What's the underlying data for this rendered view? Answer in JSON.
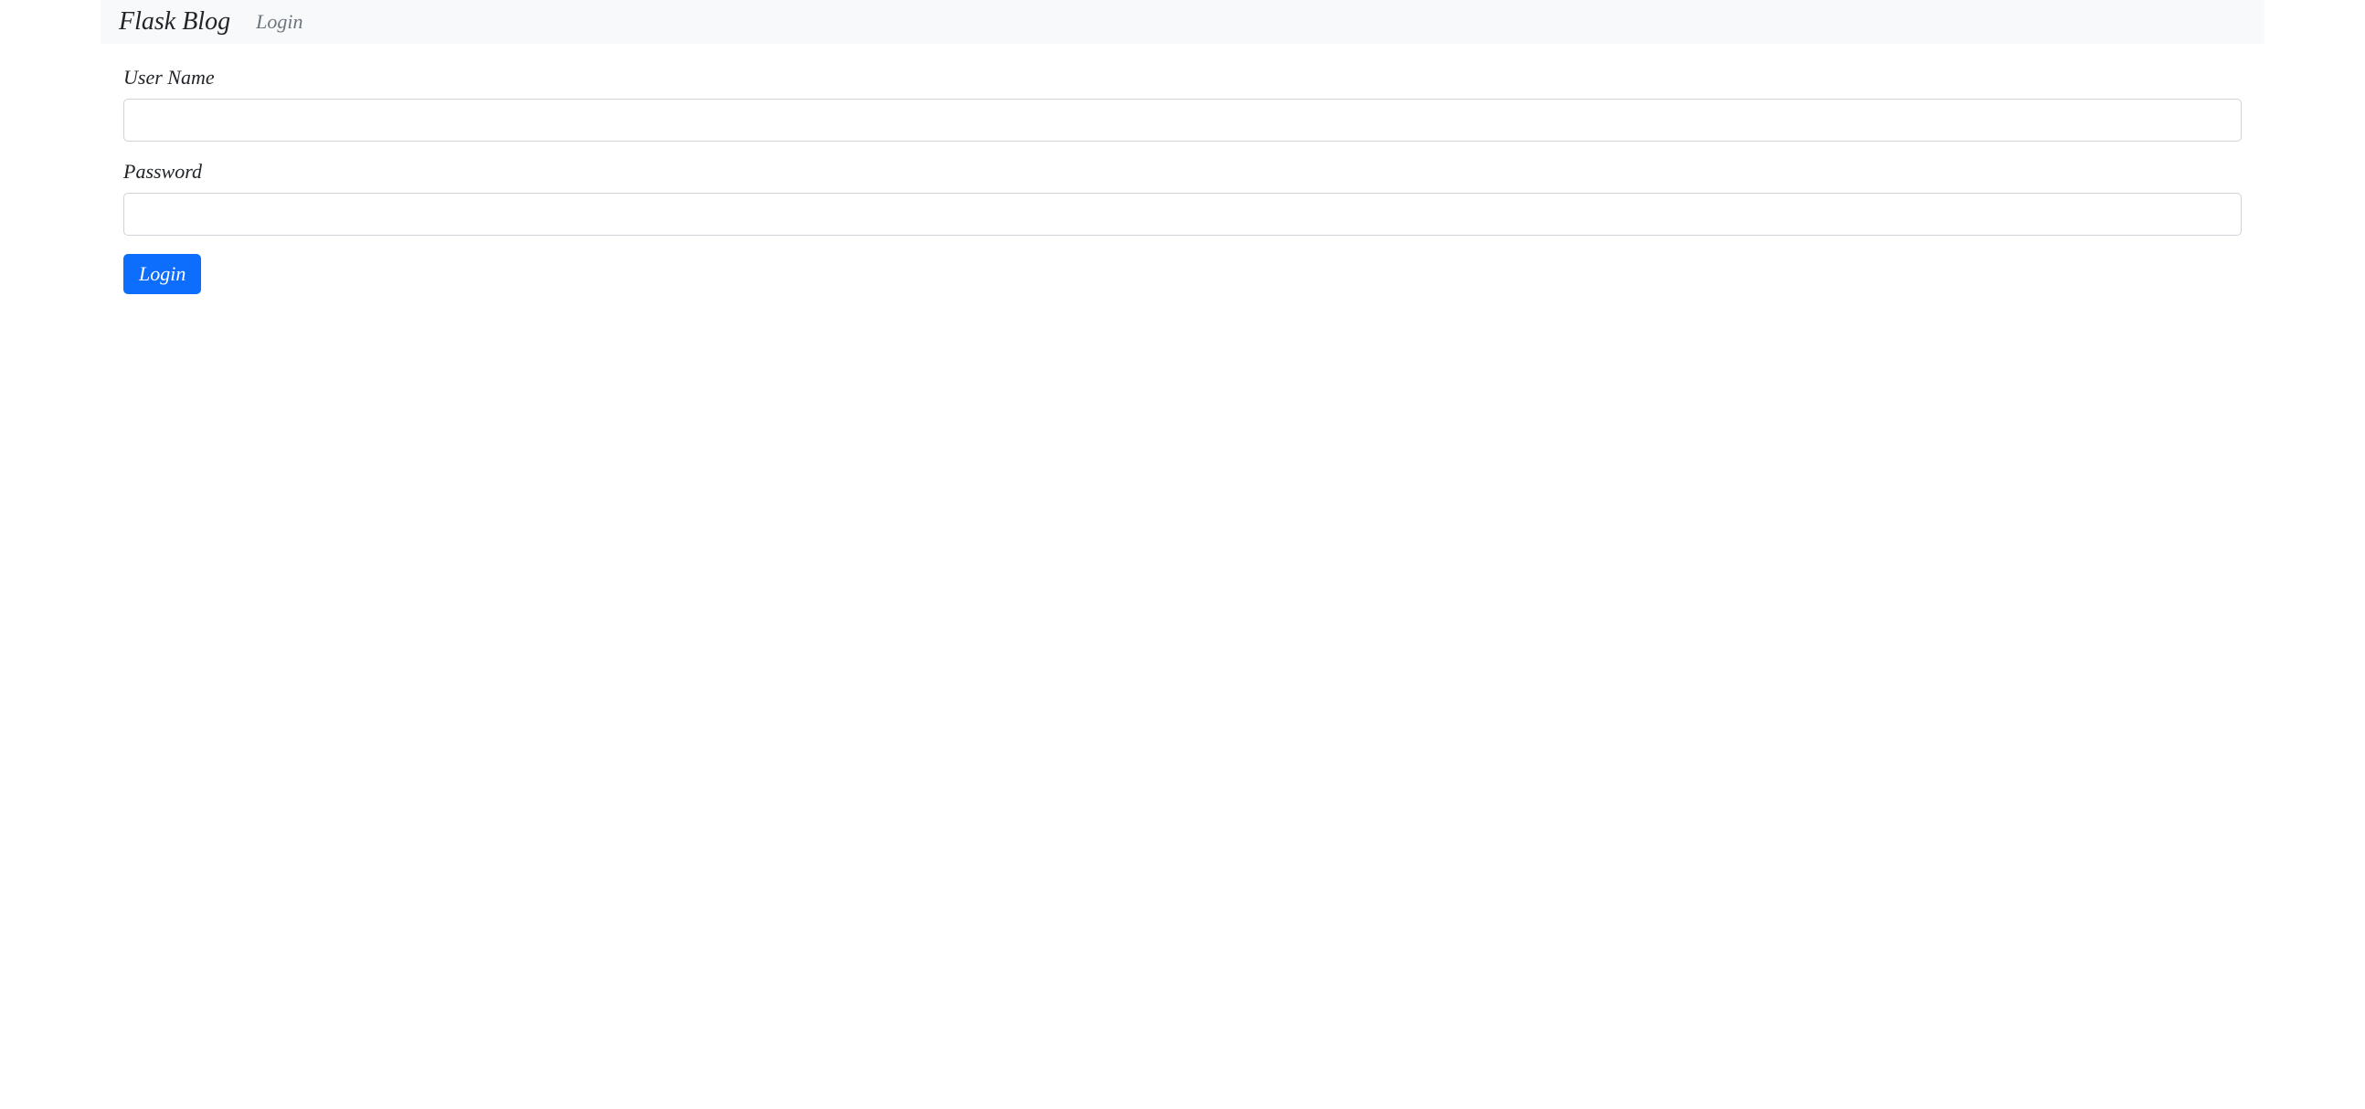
{
  "navbar": {
    "brand": "Flask Blog",
    "login_link": "Login"
  },
  "form": {
    "username_label": "User Name",
    "password_label": "Password",
    "submit_label": "Login"
  }
}
